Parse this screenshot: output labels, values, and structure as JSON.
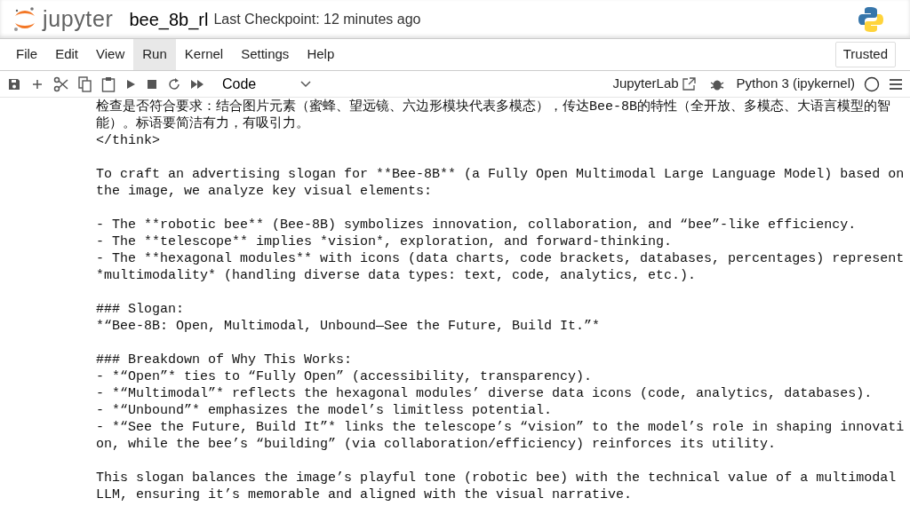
{
  "header": {
    "logo_text": "jupyter",
    "notebook_name": "bee_8b_rl",
    "checkpoint": "Last Checkpoint: 12 minutes ago"
  },
  "menu": [
    {
      "label": "File",
      "selected": false
    },
    {
      "label": "Edit",
      "selected": false
    },
    {
      "label": "View",
      "selected": false
    },
    {
      "label": "Run",
      "selected": true
    },
    {
      "label": "Kernel",
      "selected": false
    },
    {
      "label": "Settings",
      "selected": false
    },
    {
      "label": "Help",
      "selected": false
    }
  ],
  "trusted": "Trusted",
  "toolbar": {
    "cell_type": "Code",
    "jupyterlab_link": "JupyterLab",
    "kernel": "Python 3 (ipykernel)",
    "kernel_busy": false
  },
  "output": [
    {
      "lines": [
        "检查是否符合要求：结合图片元素（蜜蜂、望远镜、六边形模块代表多模态），传达Bee-8B的特性（全开放、多模态、大语言模型的智",
        "能）。标语要简洁有力，有吸引力。",
        "</think>"
      ]
    },
    {
      "lines": [
        "To craft an advertising slogan for **Bee-8B** (a Fully Open Multimodal Large Language Model) based on",
        "the image, we analyze key visual elements:"
      ]
    },
    {
      "lines": [
        "- The **robotic bee** (Bee-8B) symbolizes innovation, collaboration, and “bee”-like efficiency.",
        "- The **telescope** implies *vision*, exploration, and forward-thinking.",
        "- The **hexagonal modules** with icons (data charts, code brackets, databases, percentages) represent",
        "*multimodality* (handling diverse data types: text, code, analytics, etc.)."
      ]
    },
    {
      "lines": [
        "### Slogan:",
        "*“Bee-8B: Open, Multimodal, Unbound—See the Future, Build It.”*"
      ]
    },
    {
      "lines": [
        "### Breakdown of Why This Works:",
        "- *“Open”* ties to “Fully Open” (accessibility, transparency).",
        "- *“Multimodal”* reflects the hexagonal modules’ diverse data icons (code, analytics, databases).",
        "- *“Unbound”* emphasizes the model’s limitless potential.",
        "- *“See the Future, Build It”* links the telescope’s “vision” to the model’s role in shaping innovati",
        "on, while the bee’s “building” (via collaboration/efficiency) reinforces its utility."
      ]
    },
    {
      "lines": [
        "This slogan balances the image’s playful tone (robotic bee) with the technical value of a multimodal",
        "LLM, ensuring it’s memorable and aligned with the visual narrative."
      ]
    }
  ]
}
